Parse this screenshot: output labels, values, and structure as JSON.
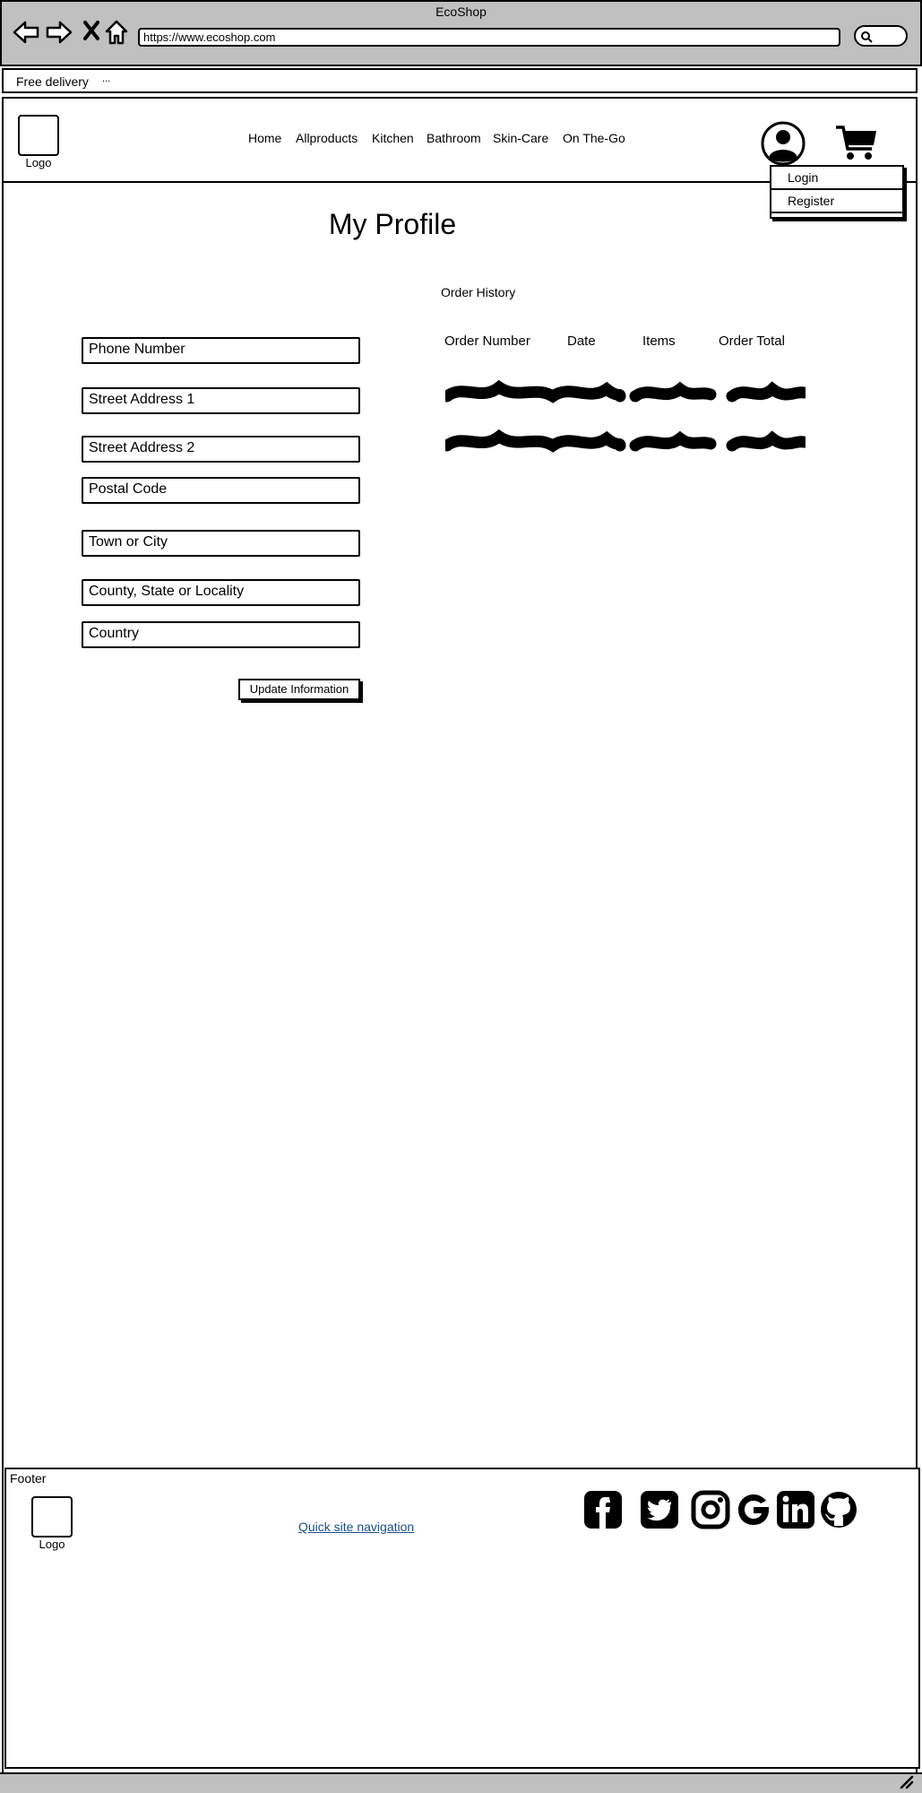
{
  "browser": {
    "title": "EcoShop",
    "url": "https://www.ecoshop.com"
  },
  "banner": {
    "text": "Free delivery",
    "more": "..."
  },
  "header": {
    "logo_label": "Logo",
    "nav": [
      "Home",
      "Allproducts",
      "Kitchen",
      "Bathroom",
      "Skin-Care",
      "On The-Go"
    ],
    "account_menu": [
      "Login",
      "Register"
    ]
  },
  "profile": {
    "title": "My Profile",
    "fields": [
      "Phone Number",
      "Street Address 1",
      "Street Address 2",
      "Postal Code",
      "Town or City",
      "County, State or Locality",
      "Country"
    ],
    "update_button": "Update Information"
  },
  "order_history": {
    "label": "Order History",
    "columns": [
      "Order Number",
      "Date",
      "Items",
      "Order Total"
    ]
  },
  "footer": {
    "label": "Footer",
    "logo_label": "Logo",
    "quick_nav": "Quick site navigation",
    "social_icons": [
      "facebook-icon",
      "twitter-icon",
      "instagram-icon",
      "google-icon",
      "linkedin-icon",
      "github-icon"
    ]
  }
}
